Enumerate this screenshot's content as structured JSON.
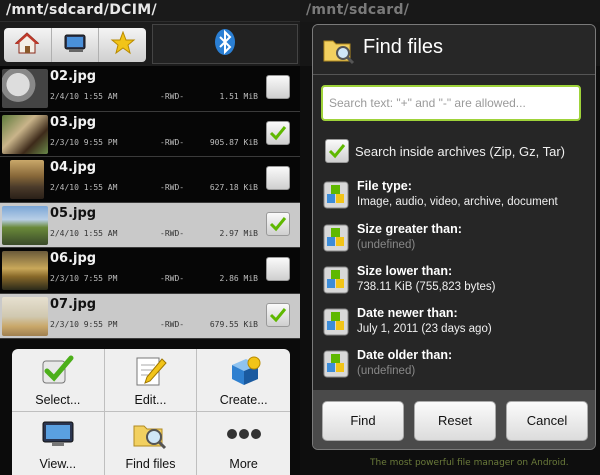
{
  "left_pane": {
    "path": "/mnt/sdcard/DCIM/",
    "toolbar_icons": [
      "home-icon",
      "device-icon",
      "bookmark-star-icon",
      "bluetooth-icon"
    ],
    "files": [
      {
        "name": "02.jpg",
        "date": "2/4/10 1:55 AM",
        "attr": "-RWD-",
        "size": "1.51 MiB",
        "checked": false,
        "selected": false
      },
      {
        "name": "03.jpg",
        "date": "2/3/10 9:55 PM",
        "attr": "-RWD-",
        "size": "905.87 KiB",
        "checked": true,
        "selected": false
      },
      {
        "name": "04.jpg",
        "date": "2/4/10 1:55 AM",
        "attr": "-RWD-",
        "size": "627.18 KiB",
        "checked": false,
        "selected": false
      },
      {
        "name": "05.jpg",
        "date": "2/4/10 1:55 AM",
        "attr": "-RWD-",
        "size": "2.97 MiB",
        "checked": true,
        "selected": true
      },
      {
        "name": "06.jpg",
        "date": "2/3/10 7:55 PM",
        "attr": "-RWD-",
        "size": "2.86 MiB",
        "checked": false,
        "selected": false
      },
      {
        "name": "07.jpg",
        "date": "2/3/10 9:55 PM",
        "attr": "-RWD-",
        "size": "679.55 KiB",
        "checked": true,
        "selected": true
      }
    ],
    "menu": [
      {
        "label": "Select...",
        "icon": "checkmark-icon"
      },
      {
        "label": "Edit...",
        "icon": "edit-icon"
      },
      {
        "label": "Create...",
        "icon": "create-icon"
      },
      {
        "label": "View...",
        "icon": "view-icon"
      },
      {
        "label": "Find files",
        "icon": "find-files-icon"
      },
      {
        "label": "More",
        "icon": "more-icon"
      }
    ]
  },
  "right_pane": {
    "path": "/mnt/sdcard/",
    "footer_text": "The most powerful file manager on Android.",
    "dialog": {
      "title": "Find files",
      "search_placeholder": "Search text: \"+\" and \"-\" are allowed...",
      "search_value": "",
      "archives_label": "Search inside archives (Zip, Gz, Tar)",
      "archives_checked": true,
      "criteria": [
        {
          "label": "File type:",
          "value": "Image, audio, video, archive, document",
          "undefined": false
        },
        {
          "label": "Size greater than:",
          "value": "(undefined)",
          "undefined": true
        },
        {
          "label": "Size lower than:",
          "value": "738.11 KiB (755,823 bytes)",
          "undefined": false
        },
        {
          "label": "Date newer than:",
          "value": "July 1, 2011 (23 days ago)",
          "undefined": false
        },
        {
          "label": "Date older than:",
          "value": "(undefined)",
          "undefined": true
        }
      ],
      "buttons": {
        "find": "Find",
        "reset": "Reset",
        "cancel": "Cancel"
      }
    }
  },
  "colors": {
    "accent_green": "#9fd33a",
    "selected_row": "#c9c9c9"
  }
}
